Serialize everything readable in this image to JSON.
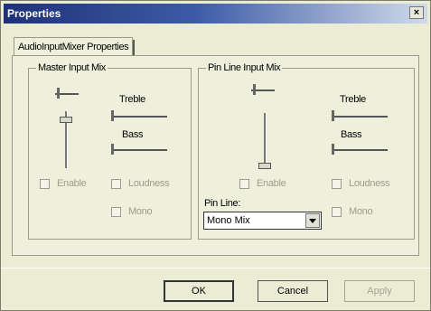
{
  "window": {
    "title": "Properties",
    "close_glyph": "×"
  },
  "tab": {
    "label": "AudioInputMixer Properties"
  },
  "master": {
    "legend": "Master Input Mix",
    "volume_level": 0.9,
    "balance_level": 0.1,
    "treble_label": "Treble",
    "treble_level": 0.0,
    "bass_label": "Bass",
    "bass_level": 0.0,
    "enable_label": "Enable",
    "loudness_label": "Loudness",
    "mono_label": "Mono",
    "enable_checked": false,
    "loudness_checked": false,
    "mono_checked": false
  },
  "pin": {
    "legend": "Pin Line Input Mix",
    "volume_level": 0.0,
    "balance_level": 0.1,
    "treble_label": "Treble",
    "treble_level": 0.0,
    "bass_label": "Bass",
    "bass_level": 0.0,
    "enable_label": "Enable",
    "loudness_label": "Loudness",
    "mono_label": "Mono",
    "pinline_label": "Pin Line:",
    "pinline_value": "Mono Mix"
  },
  "buttons": {
    "ok": "OK",
    "cancel": "Cancel",
    "apply": "Apply"
  },
  "colors": {
    "title_start": "#1f3178",
    "dialog_bg": "#eaecd4"
  },
  "icons": {
    "close": "close-icon",
    "dropdown": "chevron-down-icon"
  }
}
